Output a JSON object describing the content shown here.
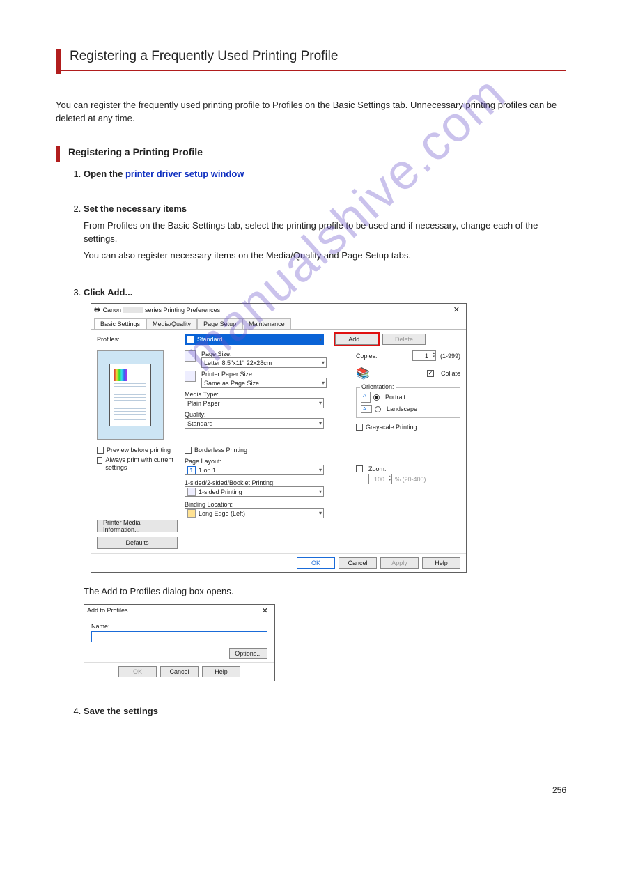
{
  "page": {
    "title": "Registering a Frequently Used Printing Profile",
    "intro": "You can register the frequently used printing profile to Profiles on the Basic Settings tab. Unnecessary printing profiles can be deleted at any time.",
    "section1": "Registering a Printing Profile"
  },
  "steps": {
    "s1_head": "Open the printer driver setup window",
    "s1_link": "printer driver setup window",
    "s2_head": "Set the necessary items",
    "s2_body1": "From Profiles on the Basic Settings tab, select the printing profile to be used and if necessary, change each of the settings.",
    "s2_body2": "You can also register necessary items on the Media/Quality and Page Setup tabs.",
    "s3_head": "Click Add...",
    "s3_after": "The Add to Profiles dialog box opens.",
    "s4_head": "Save the settings"
  },
  "dlg": {
    "title_prefix": "Canon",
    "title_suffix": "series Printing Preferences",
    "tabs": {
      "t1": "Basic Settings",
      "t2": "Media/Quality",
      "t3": "Page Setup",
      "t4": "Maintenance"
    },
    "profiles_label": "Profiles:",
    "profile_selected": "Standard",
    "add": "Add...",
    "delete": "Delete",
    "page_size_label": "Page Size:",
    "page_size_value": "Letter 8.5\"x11\" 22x28cm",
    "printer_paper_label": "Printer Paper Size:",
    "printer_paper_value": "Same as Page Size",
    "media_type_label": "Media Type:",
    "media_type_value": "Plain Paper",
    "quality_label": "Quality:",
    "quality_value": "Standard",
    "copies_label": "Copies:",
    "copies_value": "1",
    "copies_range": "(1-999)",
    "collate": "Collate",
    "orientation_label": "Orientation:",
    "portrait": "Portrait",
    "landscape": "Landscape",
    "grayscale": "Grayscale Printing",
    "preview_before": "Preview before printing",
    "always_print": "Always print with current settings",
    "borderless": "Borderless Printing",
    "page_layout_label": "Page Layout:",
    "page_layout_value": "1 on 1",
    "zoom_label": "Zoom:",
    "zoom_value": "100",
    "zoom_range": "% (20-400)",
    "sided_label": "1-sided/2-sided/Booklet Printing:",
    "sided_value": "1-sided Printing",
    "binding_label": "Binding Location:",
    "binding_value": "Long Edge (Left)",
    "pmi": "Printer Media Information...",
    "defaults": "Defaults",
    "ok": "OK",
    "cancel": "Cancel",
    "apply": "Apply",
    "help": "Help"
  },
  "small": {
    "title": "Add to Profiles",
    "name": "Name:",
    "options": "Options...",
    "ok": "OK",
    "cancel": "Cancel",
    "help": "Help"
  },
  "watermark": "manualshive.com",
  "page_no": "256"
}
